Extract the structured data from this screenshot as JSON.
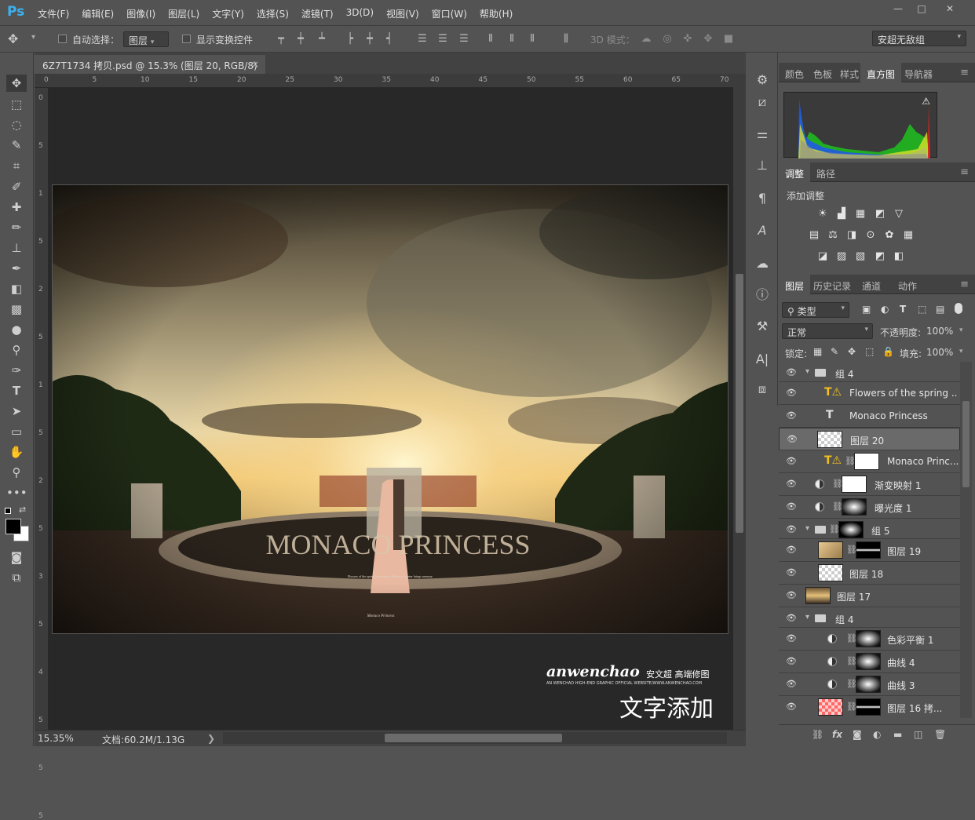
{
  "app": {
    "logo": "Ps"
  },
  "menu": [
    "文件(F)",
    "编辑(E)",
    "图像(I)",
    "图层(L)",
    "文字(Y)",
    "选择(S)",
    "滤镜(T)",
    "3D(D)",
    "视图(V)",
    "窗口(W)",
    "帮助(H)"
  ],
  "window_controls": {
    "minimize": "—",
    "maximize": "□",
    "close": "✕"
  },
  "options": {
    "auto_select_label": "自动选择：",
    "auto_select_value": "图层",
    "show_transform_label": "显示变换控件",
    "mode_3d_label": "3D 模式：",
    "workspace": "安超无敌组"
  },
  "document": {
    "tab_title": "6Z7T1734 拷贝.psd @ 15.3% (图层 20, RGB/8) *",
    "close": "×"
  },
  "ruler": {
    "top": [
      "0",
      "5",
      "10",
      "15",
      "20",
      "25",
      "30",
      "35",
      "40",
      "45",
      "50",
      "55",
      "60",
      "65",
      "70"
    ],
    "left": [
      "0",
      "5",
      "1",
      "5",
      "2",
      "5",
      "1",
      "5",
      "2",
      "5",
      "3",
      "5",
      "4",
      "5",
      "5",
      "5"
    ]
  },
  "status": {
    "zoom": "15.35%",
    "doc": "文档:60.2M/1.13G",
    "arrow": "❯"
  },
  "photo": {
    "title_text": "MONACO PRINCESS",
    "body_line1": "Flowers of the spring have come, stillness of winter brings memory",
    "sub_title": "Monaco Princess"
  },
  "watermark": {
    "brand": "anwenchao",
    "brand_cn": "安文超 高端修图",
    "tagline": "AN WENCHAO HIGH-END GRAPHIC OFFICIAL WEBSITE/WWW.ANWENCHAO.COM",
    "caption": "文字添加"
  },
  "panels": {
    "top_tabs": [
      "颜色",
      "色板",
      "样式",
      "直方图",
      "导航器"
    ],
    "adj_tabs": [
      "调整",
      "路径"
    ],
    "adj_title": "添加调整",
    "layer_tabs": [
      "图层",
      "历史记录",
      "通道",
      "动作"
    ],
    "filter_kind": "类型",
    "blend_mode": "正常",
    "opacity_label": "不透明度:",
    "opacity_value": "100%",
    "lock_label": "锁定:",
    "fill_label": "填充:",
    "fill_value": "100%"
  },
  "layers": [
    {
      "name": "组 4",
      "kind": "group"
    },
    {
      "name": "Flowers of the spring ...",
      "kind": "text-warn"
    },
    {
      "name": "Monaco Princess",
      "kind": "text"
    },
    {
      "name": "图层 20",
      "kind": "empty",
      "selected": true
    },
    {
      "name": "Monaco Princ...",
      "kind": "text-mask"
    },
    {
      "name": "渐变映射 1",
      "kind": "adjust"
    },
    {
      "name": "曝光度 1",
      "kind": "adjust"
    },
    {
      "name": "组 5",
      "kind": "group-mask"
    },
    {
      "name": "图层 19",
      "kind": "image-mask"
    },
    {
      "name": "图层 18",
      "kind": "image"
    },
    {
      "name": "图层 17",
      "kind": "image-top"
    },
    {
      "name": "组 4",
      "kind": "group"
    },
    {
      "name": "色彩平衡 1",
      "kind": "adjust"
    },
    {
      "name": "曲线 4",
      "kind": "adjust"
    },
    {
      "name": "曲线 3",
      "kind": "adjust"
    },
    {
      "name": "图层 16 拷...",
      "kind": "image-mask"
    }
  ],
  "colors": {
    "accent": "#3bb1f0",
    "panel_bg": "#535353",
    "dark_bg": "#282828"
  }
}
